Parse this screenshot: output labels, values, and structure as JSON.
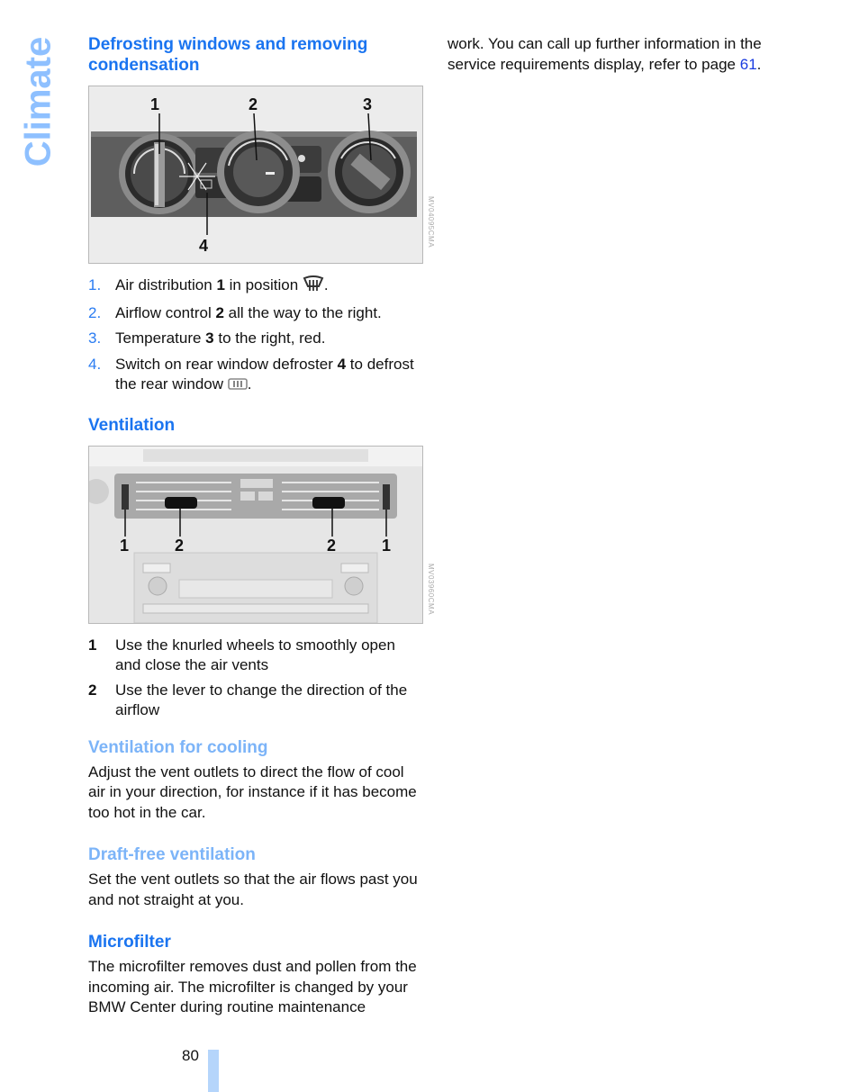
{
  "side_tab": {
    "label": "Climate",
    "color": "#8ec0ff"
  },
  "left_column": {
    "section_defrost": {
      "heading": "Defrosting windows and removing condensation",
      "figure": {
        "callouts": [
          "1",
          "2",
          "3",
          "4"
        ],
        "image_code": "MV04095CMA"
      },
      "steps": [
        {
          "num": "1.",
          "pre": "Air distribution ",
          "bold": "1",
          "post": " in position ",
          "icon": "windshield-defrost-icon",
          "end": "."
        },
        {
          "num": "2.",
          "pre": "Airflow control ",
          "bold": "2",
          "post": " all the way to the right.",
          "icon": null,
          "end": ""
        },
        {
          "num": "3.",
          "pre": "Temperature ",
          "bold": "3",
          "post": " to the right, red.",
          "icon": null,
          "end": ""
        },
        {
          "num": "4.",
          "pre": "Switch on rear window defroster ",
          "bold": "4",
          "post": " to defrost the rear window ",
          "icon": "rear-window-defrost-icon",
          "end": "."
        }
      ]
    },
    "section_ventilation": {
      "heading": "Ventilation",
      "figure": {
        "callouts": [
          "1",
          "2",
          "2",
          "1"
        ],
        "image_code": "MV03960CMA"
      },
      "legend": [
        {
          "num": "1",
          "text": "Use the knurled wheels to smoothly open and close the air vents"
        },
        {
          "num": "2",
          "text": "Use the lever to change the direction of the airflow"
        }
      ]
    },
    "section_cooling": {
      "heading": "Ventilation for cooling",
      "body": "Adjust the vent outlets to direct the flow of cool air in your direction, for instance if it has become too hot in the car."
    },
    "section_draft_free": {
      "heading": "Draft-free ventilation",
      "body": "Set the vent outlets so that the air flows past you and not straight at you."
    },
    "section_microfilter": {
      "heading": "Microfilter",
      "body": "The microfilter removes dust and pollen from the incoming air. The microfilter is changed by your BMW Center during routine maintenance"
    }
  },
  "right_column": {
    "continued_text": "work. You can call up further information in the service requirements display, refer to page ",
    "page_link": "61",
    "end": "."
  },
  "footer": {
    "page_number": "80"
  },
  "colors": {
    "heading": "#1a74f0",
    "subheading": "#7cb4f8",
    "link": "#1a3ce0",
    "page_bar": "#b5d5fb"
  }
}
